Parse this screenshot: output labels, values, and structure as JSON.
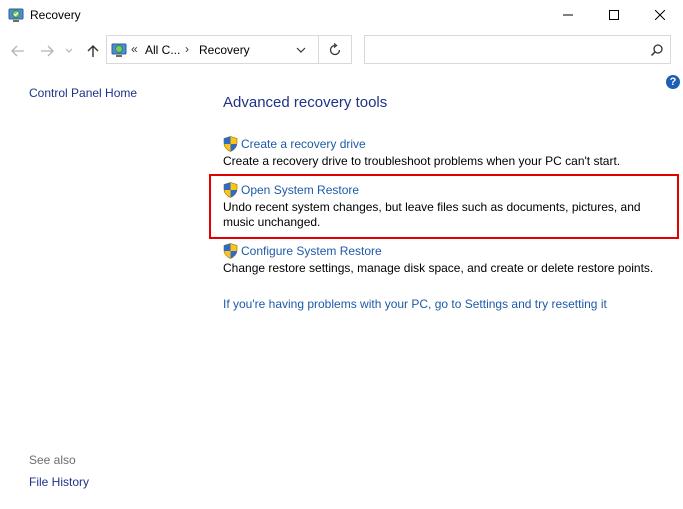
{
  "window": {
    "title": "Recovery",
    "icon": "recovery-icon",
    "controls": [
      "minimize-icon",
      "maximize-icon",
      "close-icon"
    ]
  },
  "navigation": {
    "back": "back-arrow-icon",
    "forward": "forward-arrow-icon",
    "recent": "chevron-down-icon",
    "up": "up-arrow-icon",
    "address": {
      "overflow": "«",
      "segment1": "All C...",
      "separator": "›",
      "segment2": "Recovery"
    },
    "refresh": "refresh-icon",
    "search": {
      "value": "",
      "placeholder": ""
    }
  },
  "left_pane": {
    "home_link": "Control Panel Home",
    "see_also": "See also",
    "see_also_links": [
      "File History"
    ]
  },
  "main": {
    "heading": "Advanced recovery tools",
    "tools": [
      {
        "link": "Create a recovery drive",
        "description": "Create a recovery drive to troubleshoot problems when your PC can't start."
      },
      {
        "link": "Open System Restore",
        "description": "Undo recent system changes, but leave files such as documents, pictures, and music unchanged."
      },
      {
        "link": "Configure System Restore",
        "description": "Change restore settings, manage disk space, and create or delete restore points."
      }
    ],
    "settings_link": "If you're having problems with your PC, go to Settings and try resetting it"
  },
  "help": "?",
  "colors": {
    "heading": "#1e3287",
    "link": "#1e5aa8",
    "highlight": "#e00000"
  }
}
